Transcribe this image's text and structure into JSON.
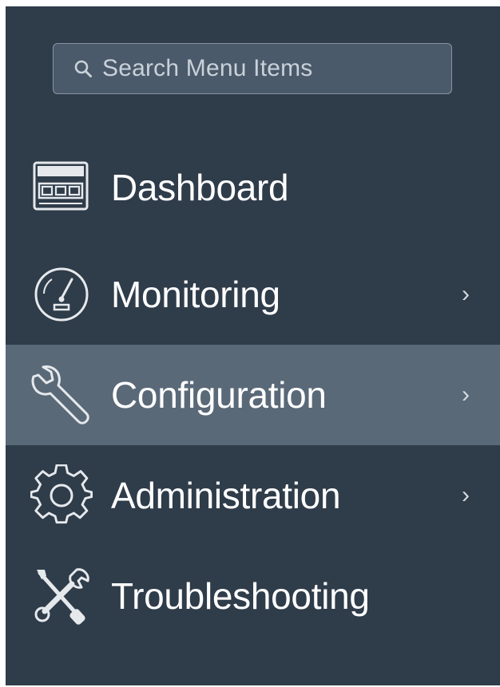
{
  "search": {
    "placeholder": "Search Menu Items",
    "icon": "search-icon"
  },
  "menu": {
    "items": [
      {
        "label": "Dashboard",
        "icon": "dashboard-icon",
        "has_submenu": false,
        "active": false
      },
      {
        "label": "Monitoring",
        "icon": "gauge-icon",
        "has_submenu": true,
        "active": false
      },
      {
        "label": "Configuration",
        "icon": "wrench-icon",
        "has_submenu": true,
        "active": true
      },
      {
        "label": "Administration",
        "icon": "gear-icon",
        "has_submenu": true,
        "active": false
      },
      {
        "label": "Troubleshooting",
        "icon": "tools-icon",
        "has_submenu": false,
        "active": false
      }
    ],
    "chevron": "›"
  },
  "colors": {
    "panel_bg": "#2f3c4a",
    "active_bg": "#5a6978",
    "search_bg": "#4b5a6a",
    "text": "#ffffff"
  }
}
